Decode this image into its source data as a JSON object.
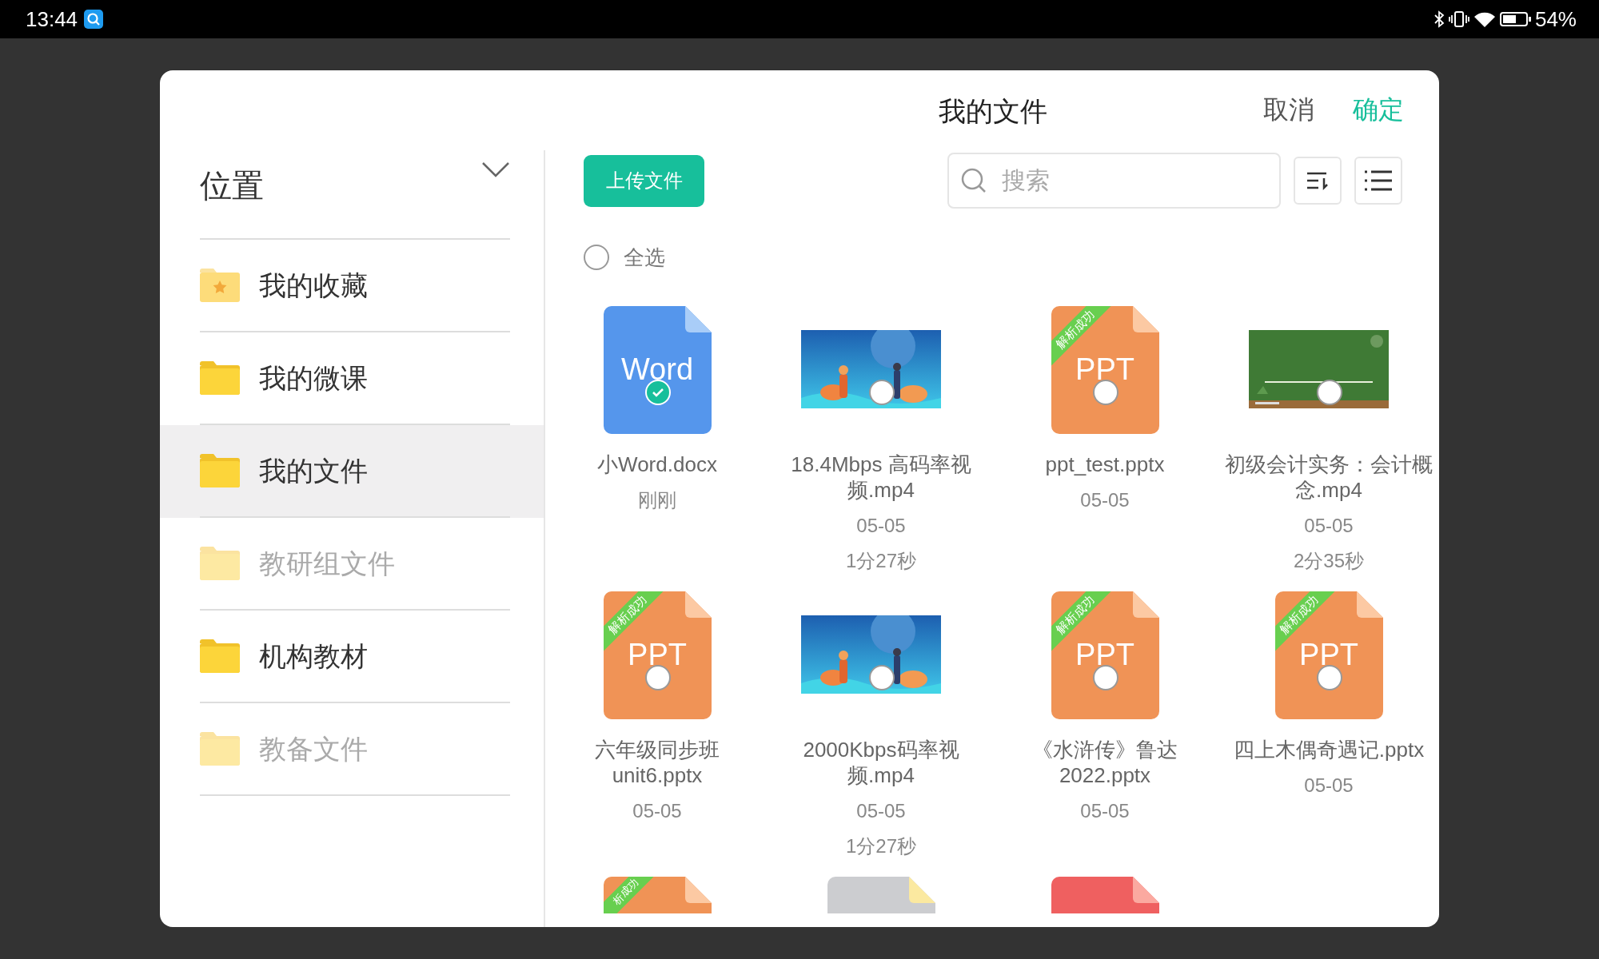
{
  "status_bar": {
    "time": "13:44",
    "battery": "54%"
  },
  "dialog": {
    "title": "我的文件",
    "cancel": "取消",
    "confirm": "确定"
  },
  "sidebar": {
    "heading": "位置",
    "items": [
      {
        "label": "我的收藏",
        "kind": "favorites",
        "disabled": false,
        "selected": false
      },
      {
        "label": "我的微课",
        "kind": "folder",
        "disabled": false,
        "selected": false
      },
      {
        "label": "我的文件",
        "kind": "folder",
        "disabled": false,
        "selected": true
      },
      {
        "label": "教研组文件",
        "kind": "folder",
        "disabled": true,
        "selected": false
      },
      {
        "label": "机构教材",
        "kind": "folder",
        "disabled": false,
        "selected": false
      },
      {
        "label": "教备文件",
        "kind": "folder",
        "disabled": true,
        "selected": false
      }
    ]
  },
  "toolbar": {
    "upload": "上传文件",
    "search": {
      "placeholder": "搜索"
    }
  },
  "select_all": {
    "label": "全选",
    "checked": false
  },
  "files": [
    {
      "kind": "word",
      "icon_text": "Word",
      "name": "小Word.docx",
      "date": "刚刚",
      "selected": true
    },
    {
      "kind": "video",
      "name": "18.4Mbps 高码率视频.mp4",
      "date": "05-05",
      "duration": "1分27秒",
      "selected": false
    },
    {
      "kind": "ppt",
      "icon_text": "PPT",
      "ribbon": "解析成功",
      "name": "ppt_test.pptx",
      "date": "05-05",
      "selected": false
    },
    {
      "kind": "video",
      "name": "初级会计实务：会计概念.mp4",
      "date": "05-05",
      "duration": "2分35秒",
      "selected": false
    },
    {
      "kind": "ppt",
      "icon_text": "PPT",
      "ribbon": "解析成功",
      "name": "六年级同步班unit6.pptx",
      "date": "05-05",
      "selected": false
    },
    {
      "kind": "video",
      "name": "2000Kbps码率视频.mp4",
      "date": "05-05",
      "duration": "1分27秒",
      "selected": false
    },
    {
      "kind": "ppt",
      "icon_text": "PPT",
      "ribbon": "解析成功",
      "name": "《水浒传》鲁达2022.pptx",
      "date": "05-05",
      "selected": false
    },
    {
      "kind": "ppt",
      "icon_text": "PPT",
      "ribbon": "解析成功",
      "name": "四上木偶奇遇记.pptx",
      "date": "05-05",
      "selected": false
    }
  ],
  "partial_files": [
    {
      "kind": "ppt",
      "ribbon": "析成功"
    },
    {
      "kind": "other"
    },
    {
      "kind": "pdf"
    }
  ]
}
